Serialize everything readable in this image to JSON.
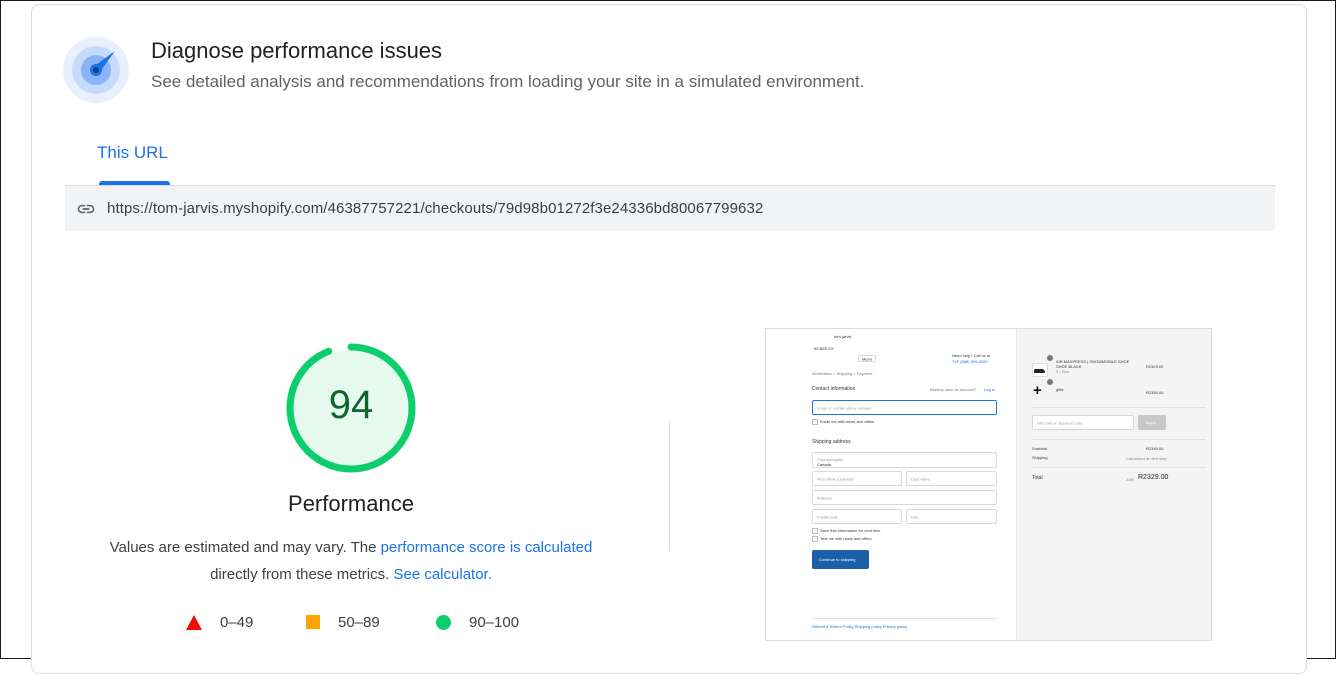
{
  "header": {
    "title": "Diagnose performance issues",
    "subtitle": "See detailed analysis and recommendations from loading your site in a simulated environment.",
    "icon": "speed-gauge-icon"
  },
  "tabs": [
    {
      "label": "This URL",
      "active": true
    }
  ],
  "url_bar": {
    "icon": "link-icon",
    "url": "https://tom-jarvis.myshopify.com/46387757221/checkouts/79d98b01272f3e24336bd80067799632"
  },
  "score": {
    "value": "94",
    "fraction": 0.94,
    "label": "Performance",
    "color": "#0cce6b",
    "text_color": "#0d652d"
  },
  "description": {
    "part1": "Values are estimated and may vary. The ",
    "link1": "performance score is calculated",
    "part2": "directly from these metrics. ",
    "link2": "See calculator."
  },
  "legend": [
    {
      "shape": "triangle",
      "range": "0–49",
      "color": "#eb0f00"
    },
    {
      "shape": "square",
      "range": "50–89",
      "color": "#ffa400"
    },
    {
      "shape": "circle",
      "range": "90–100",
      "color": "#0cce6b"
    }
  ],
  "thumbnail": {
    "store_name": "tom-jarvis",
    "store_line1": "99 BEECH",
    "help_text": "Need help? Call us at",
    "help_phone": "TLF (888) 555-0000",
    "breadcrumbs": "Information  >  Shipping  >  Payment",
    "contact_heading": "Contact information",
    "have_account": "Already have an account?",
    "login": "Log in",
    "email_placeholder": "Email or mobile phone number",
    "email_news": "Email me with news and offers",
    "shipping_heading": "Shipping address",
    "country_label": "Country/region",
    "country_value": "Canada",
    "first_name": "First name (optional)",
    "last_name": "Last name",
    "address": "Address",
    "postal": "Postal code",
    "city": "City",
    "save_info": "Save this information for next time",
    "text_news": "Text me with news and offers",
    "continue_button": "Continue to shipping",
    "footer_links": "Refund & Return Policy    Shipping policy    Privacy policy",
    "item1_name": "AIR MAXPRESS | SNOWMOBILE SHOE",
    "item1_variant": "SHOE BLACK",
    "item1_size": "9 / Size",
    "item1_price": "R2329.00",
    "item2_name": "gifte",
    "item2_price": "R2350.00",
    "discount_placeholder": "Gift card or discount code",
    "apply": "Apply",
    "subtotal_label": "Subtotal",
    "subtotal_value": "R2349.00",
    "shipping_label": "Shipping",
    "shipping_value": "Calculated at next step",
    "total_label": "Total",
    "total_currency": "ZAR",
    "total_value": "R2329.00"
  }
}
